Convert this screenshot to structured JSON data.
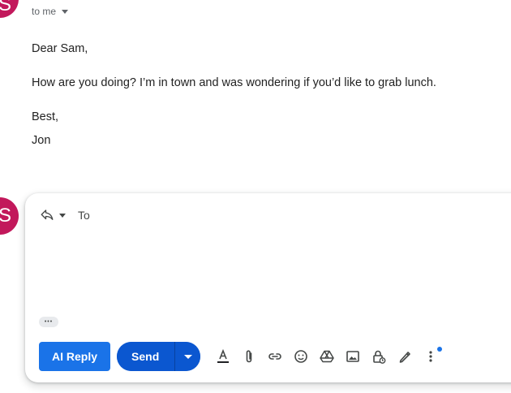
{
  "message": {
    "sender_initial": "S",
    "to_line": "to me",
    "greeting": "Dear Sam,",
    "body": "How are you doing? I’m in town and was wondering if you’d like to grab lunch.",
    "signoff": "Best,",
    "signature": "Jon"
  },
  "reply": {
    "avatar_initial": "S",
    "to_label": "To",
    "dots": "•••",
    "ai_reply_label": "AI Reply",
    "send_label": "Send"
  },
  "toolbar_icons": [
    "text-format-icon",
    "attach-icon",
    "link-icon",
    "emoji-icon",
    "drive-icon",
    "photo-icon",
    "confidential-icon",
    "signature-icon",
    "more-options-icon"
  ],
  "colors": {
    "avatar": "#c2185b",
    "ai_button": "#1a73e8",
    "send_button": "#0b57d0"
  }
}
